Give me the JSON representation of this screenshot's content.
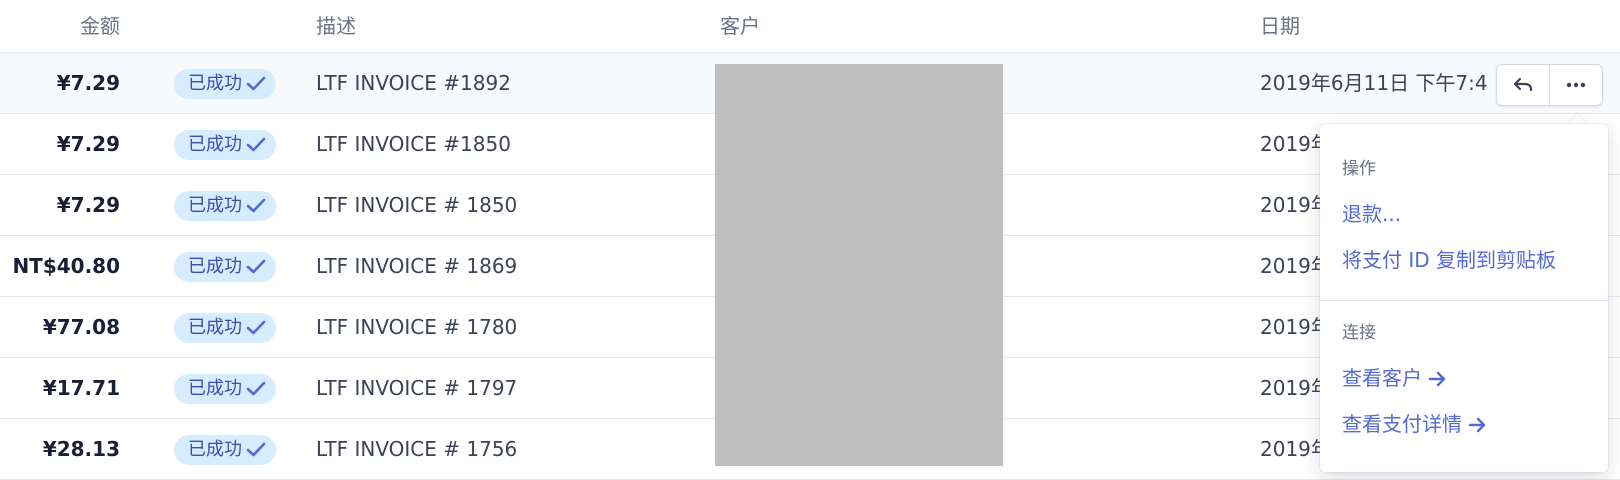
{
  "table": {
    "headers": {
      "amount": "金额",
      "description": "描述",
      "customer": "客户",
      "date": "日期"
    },
    "status_badge_label": "已成功",
    "rows": [
      {
        "amount": "¥7.29",
        "description": "LTF INVOICE #1892",
        "date": "2019年6月11日 下午7:4"
      },
      {
        "amount": "¥7.29",
        "description": "LTF INVOICE #1850",
        "date": "2019年"
      },
      {
        "amount": "¥7.29",
        "description": "LTF INVOICE # 1850",
        "date": "2019年"
      },
      {
        "amount": "NT$40.80",
        "description": "LTF INVOICE # 1869",
        "date": "2019年"
      },
      {
        "amount": "¥77.08",
        "description": "LTF INVOICE # 1780",
        "date": "2019年"
      },
      {
        "amount": "¥17.71",
        "description": "LTF INVOICE # 1797",
        "date": "2019年"
      },
      {
        "amount": "¥28.13",
        "description": "LTF INVOICE # 1756",
        "date": "2019年"
      }
    ]
  },
  "row_actions": {
    "refund_icon": "undo-arrow-icon",
    "more_icon": "ellipsis-icon"
  },
  "menu": {
    "actions_title": "操作",
    "refund": "退款...",
    "copy_id": "将支付 ID 复制到剪贴板",
    "connect_title": "连接",
    "view_customer": "查看客户",
    "view_payment": "查看支付详情"
  },
  "colors": {
    "badge_bg": "#d6ecff",
    "badge_text": "#3d4eac",
    "link": "#5469d4",
    "redacted": "#bfbfbf"
  }
}
